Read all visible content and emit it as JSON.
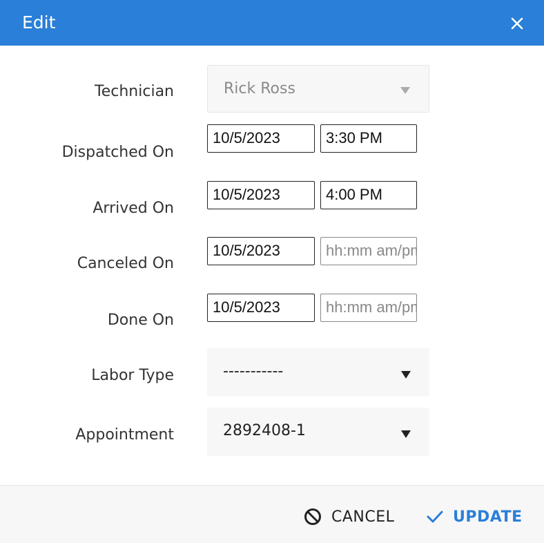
{
  "dialog": {
    "title": "Edit"
  },
  "form": {
    "technician": {
      "label": "Technician",
      "value": "Rick Ross"
    },
    "dispatched_on": {
      "label": "Dispatched On",
      "date": "10/5/2023",
      "time": "3:30 PM"
    },
    "arrived_on": {
      "label": "Arrived On",
      "date": "10/5/2023",
      "time": "4:00 PM"
    },
    "canceled_on": {
      "label": "Canceled On",
      "date": "10/5/2023",
      "time_placeholder": "hh:mm am/pm"
    },
    "done_on": {
      "label": "Done On",
      "date": "10/5/2023",
      "time_placeholder": "hh:mm am/pm"
    },
    "labor_type": {
      "label": "Labor Type",
      "value": "-----------"
    },
    "appointment": {
      "label": "Appointment",
      "value": "2892408-1"
    }
  },
  "footer": {
    "cancel_label": "CANCEL",
    "update_label": "UPDATE"
  },
  "colors": {
    "accent": "#2a7fd8",
    "footer_bg": "#f7f7f7"
  },
  "icons": {
    "close": "close-icon",
    "cancel": "ban-icon",
    "update": "check-icon",
    "dropdown": "caret-down-icon"
  }
}
